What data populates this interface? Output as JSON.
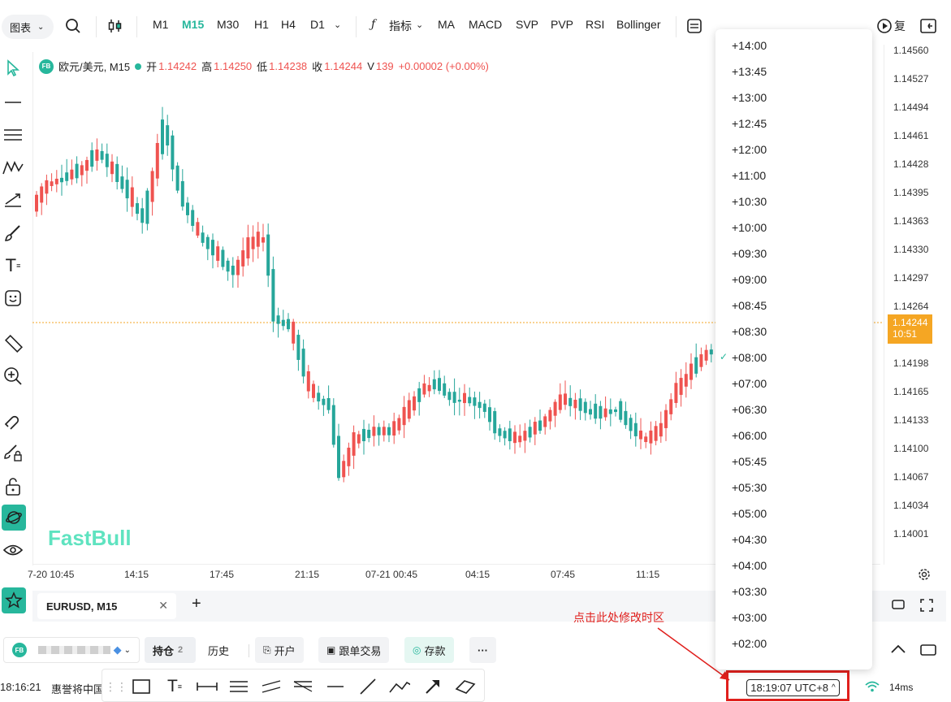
{
  "toolbar": {
    "chart_menu": "图表",
    "timeframes": [
      "M1",
      "M15",
      "M30",
      "H1",
      "H4",
      "D1"
    ],
    "active_timeframe": "M15",
    "indicators_label": "指标",
    "indicator_items": [
      "MA",
      "MACD",
      "SVP",
      "PVP",
      "RSI",
      "Bollinger"
    ],
    "replay_label": "复"
  },
  "symbol_info": {
    "badge": "FB",
    "name": "欧元/美元, M15",
    "open_label": "开",
    "open": "1.14242",
    "high_label": "高",
    "high": "1.14250",
    "low_label": "低",
    "low": "1.14238",
    "close_label": "收",
    "close": "1.14244",
    "volume_label": "V",
    "volume": "139",
    "change": "+0.00002 (+0.00%)"
  },
  "price_axis": [
    "1.14560",
    "1.14527",
    "1.14494",
    "1.14461",
    "1.14428",
    "1.14395",
    "1.14363",
    "1.14330",
    "1.14297",
    "1.14264",
    "1.14198",
    "1.14165",
    "1.14133",
    "1.14100",
    "1.14067",
    "1.14034",
    "1.14001"
  ],
  "current_price": {
    "price": "1.14244",
    "countdown": "10:51"
  },
  "time_axis": [
    "7-20 10:45",
    "14:15",
    "17:45",
    "21:15",
    "07-21 00:45",
    "04:15",
    "07:45",
    "11:15"
  ],
  "watermark": "FastBull",
  "timezone_dropdown": {
    "items": [
      "+14:00",
      "+13:45",
      "+13:00",
      "+12:45",
      "+12:00",
      "+11:00",
      "+10:30",
      "+10:00",
      "+09:30",
      "+09:00",
      "+08:45",
      "+08:30",
      "+08:00",
      "+07:00",
      "+06:30",
      "+06:00",
      "+05:45",
      "+05:30",
      "+05:00",
      "+04:30",
      "+04:00",
      "+03:30",
      "+03:00",
      "+02:00"
    ],
    "selected": "+08:00"
  },
  "tabs": {
    "active_tab": "EURUSD, M15"
  },
  "bottom": {
    "account_badge": "FB",
    "positions_label": "持仓",
    "positions_count": "2",
    "history_label": "历史",
    "open_label": "开户",
    "copy_trade_label": "跟单交易",
    "deposit_label": "存款"
  },
  "status": {
    "time": "18:16:21",
    "ticker_text": "惠誉将中国",
    "utc_clock": "18:19:07 UTC+8",
    "latency": "14ms"
  },
  "annotation": "点击此处修改时区",
  "colors": {
    "up": "#ef5350",
    "down": "#26a69a",
    "accent": "#27b79c",
    "price_tag": "#f5a623",
    "highlight": "#e0201d"
  }
}
